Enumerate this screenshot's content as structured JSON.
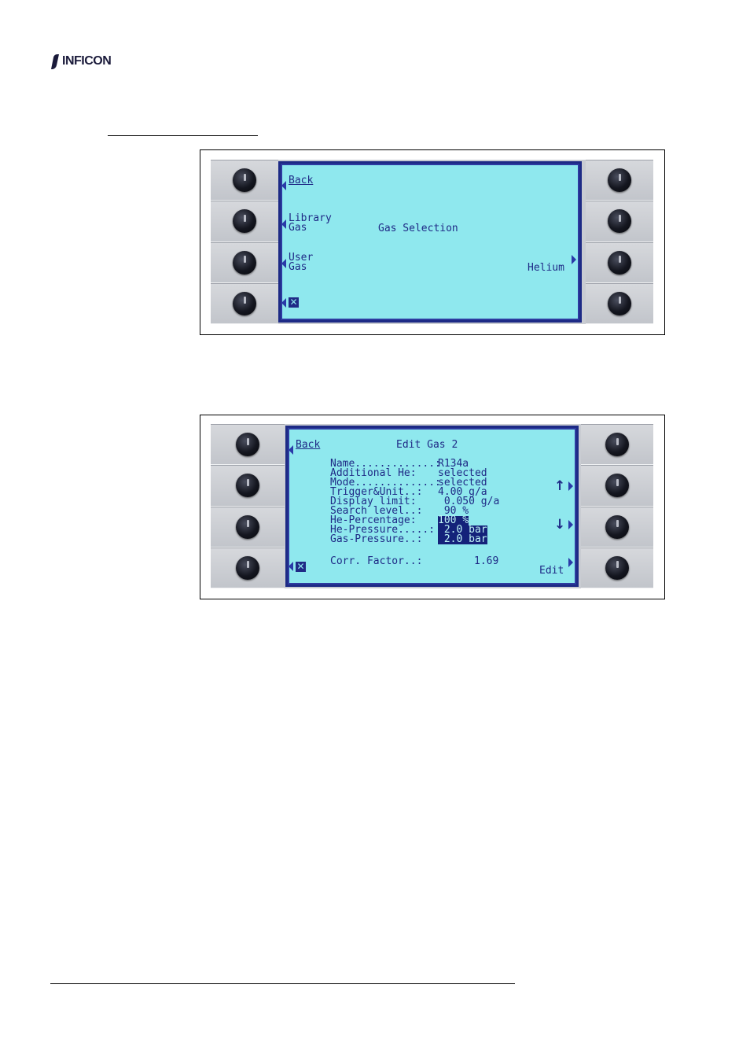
{
  "header": {
    "logo_text": "INFICON"
  },
  "figure1": {
    "screen": {
      "back": "Back",
      "library_line1": "Library",
      "library_line2": "Gas",
      "title": "Gas Selection",
      "user_line1": "User",
      "user_line2": "Gas",
      "right_option": "Helium",
      "close_icon_glyph": "✕"
    }
  },
  "figure2": {
    "screen": {
      "back": "Back",
      "title": "Edit Gas 2",
      "rows": [
        {
          "label": "Name.............:",
          "value": "R134a",
          "selected": false
        },
        {
          "label": "Additional He:",
          "value": "selected",
          "selected": false
        },
        {
          "label": "Mode.............:",
          "value": "selected",
          "selected": false
        },
        {
          "label": "Trigger&Unit..:",
          "value": "4.00 g/a",
          "selected": false
        },
        {
          "label": "Display limit:",
          "value": " 0.050 g/a",
          "selected": false
        },
        {
          "label": "Search level..:",
          "value": " 90 %",
          "selected": false
        },
        {
          "label": "He-Percentage:",
          "value": "100 %",
          "selected": true
        },
        {
          "label": "He-Pressure.....:",
          "value": " 2.0 bar",
          "selected": true
        },
        {
          "label": "Gas-Pressure..:",
          "value": " 2.0 bar",
          "selected": true
        }
      ],
      "corr_label": "Corr. Factor..:",
      "corr_value": "1.69",
      "edit": "Edit",
      "up_glyph": "↑",
      "down_glyph": "↓",
      "close_icon_glyph": "✕"
    }
  }
}
